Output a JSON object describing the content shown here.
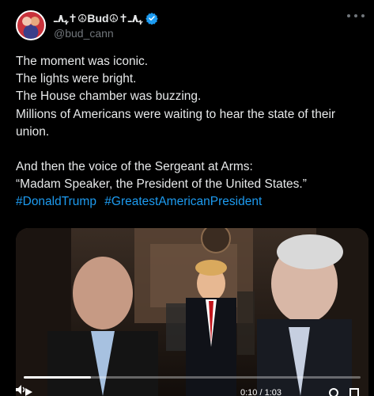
{
  "author": {
    "display_name": "ﮩ٨ـ✝☮Bud☮✝ﮩ٨ـ",
    "handle": "@bud_cann",
    "verified_icon": "verified-badge-icon",
    "verified_color": "#1d9bf0"
  },
  "menu_icon": "more-icon",
  "post": {
    "lines": [
      "The moment was iconic.",
      "The lights were bright.",
      "The House chamber was buzzing.",
      "Millions of Americans were waiting to hear the state of their union."
    ],
    "lines2": [
      "And then the voice of the Sergeant at Arms:",
      "“Madam Speaker, the President of the United States.”"
    ],
    "hashtags": [
      "#DonaldTrump",
      "#GreatestAmericanPresident"
    ],
    "hashtag_color": "#1d9bf0"
  },
  "video": {
    "progress": 0.2,
    "time": "0:10 / 1:03",
    "controls": [
      "play-icon",
      "volume-icon",
      "settings-icon",
      "fullscreen-icon"
    ]
  }
}
